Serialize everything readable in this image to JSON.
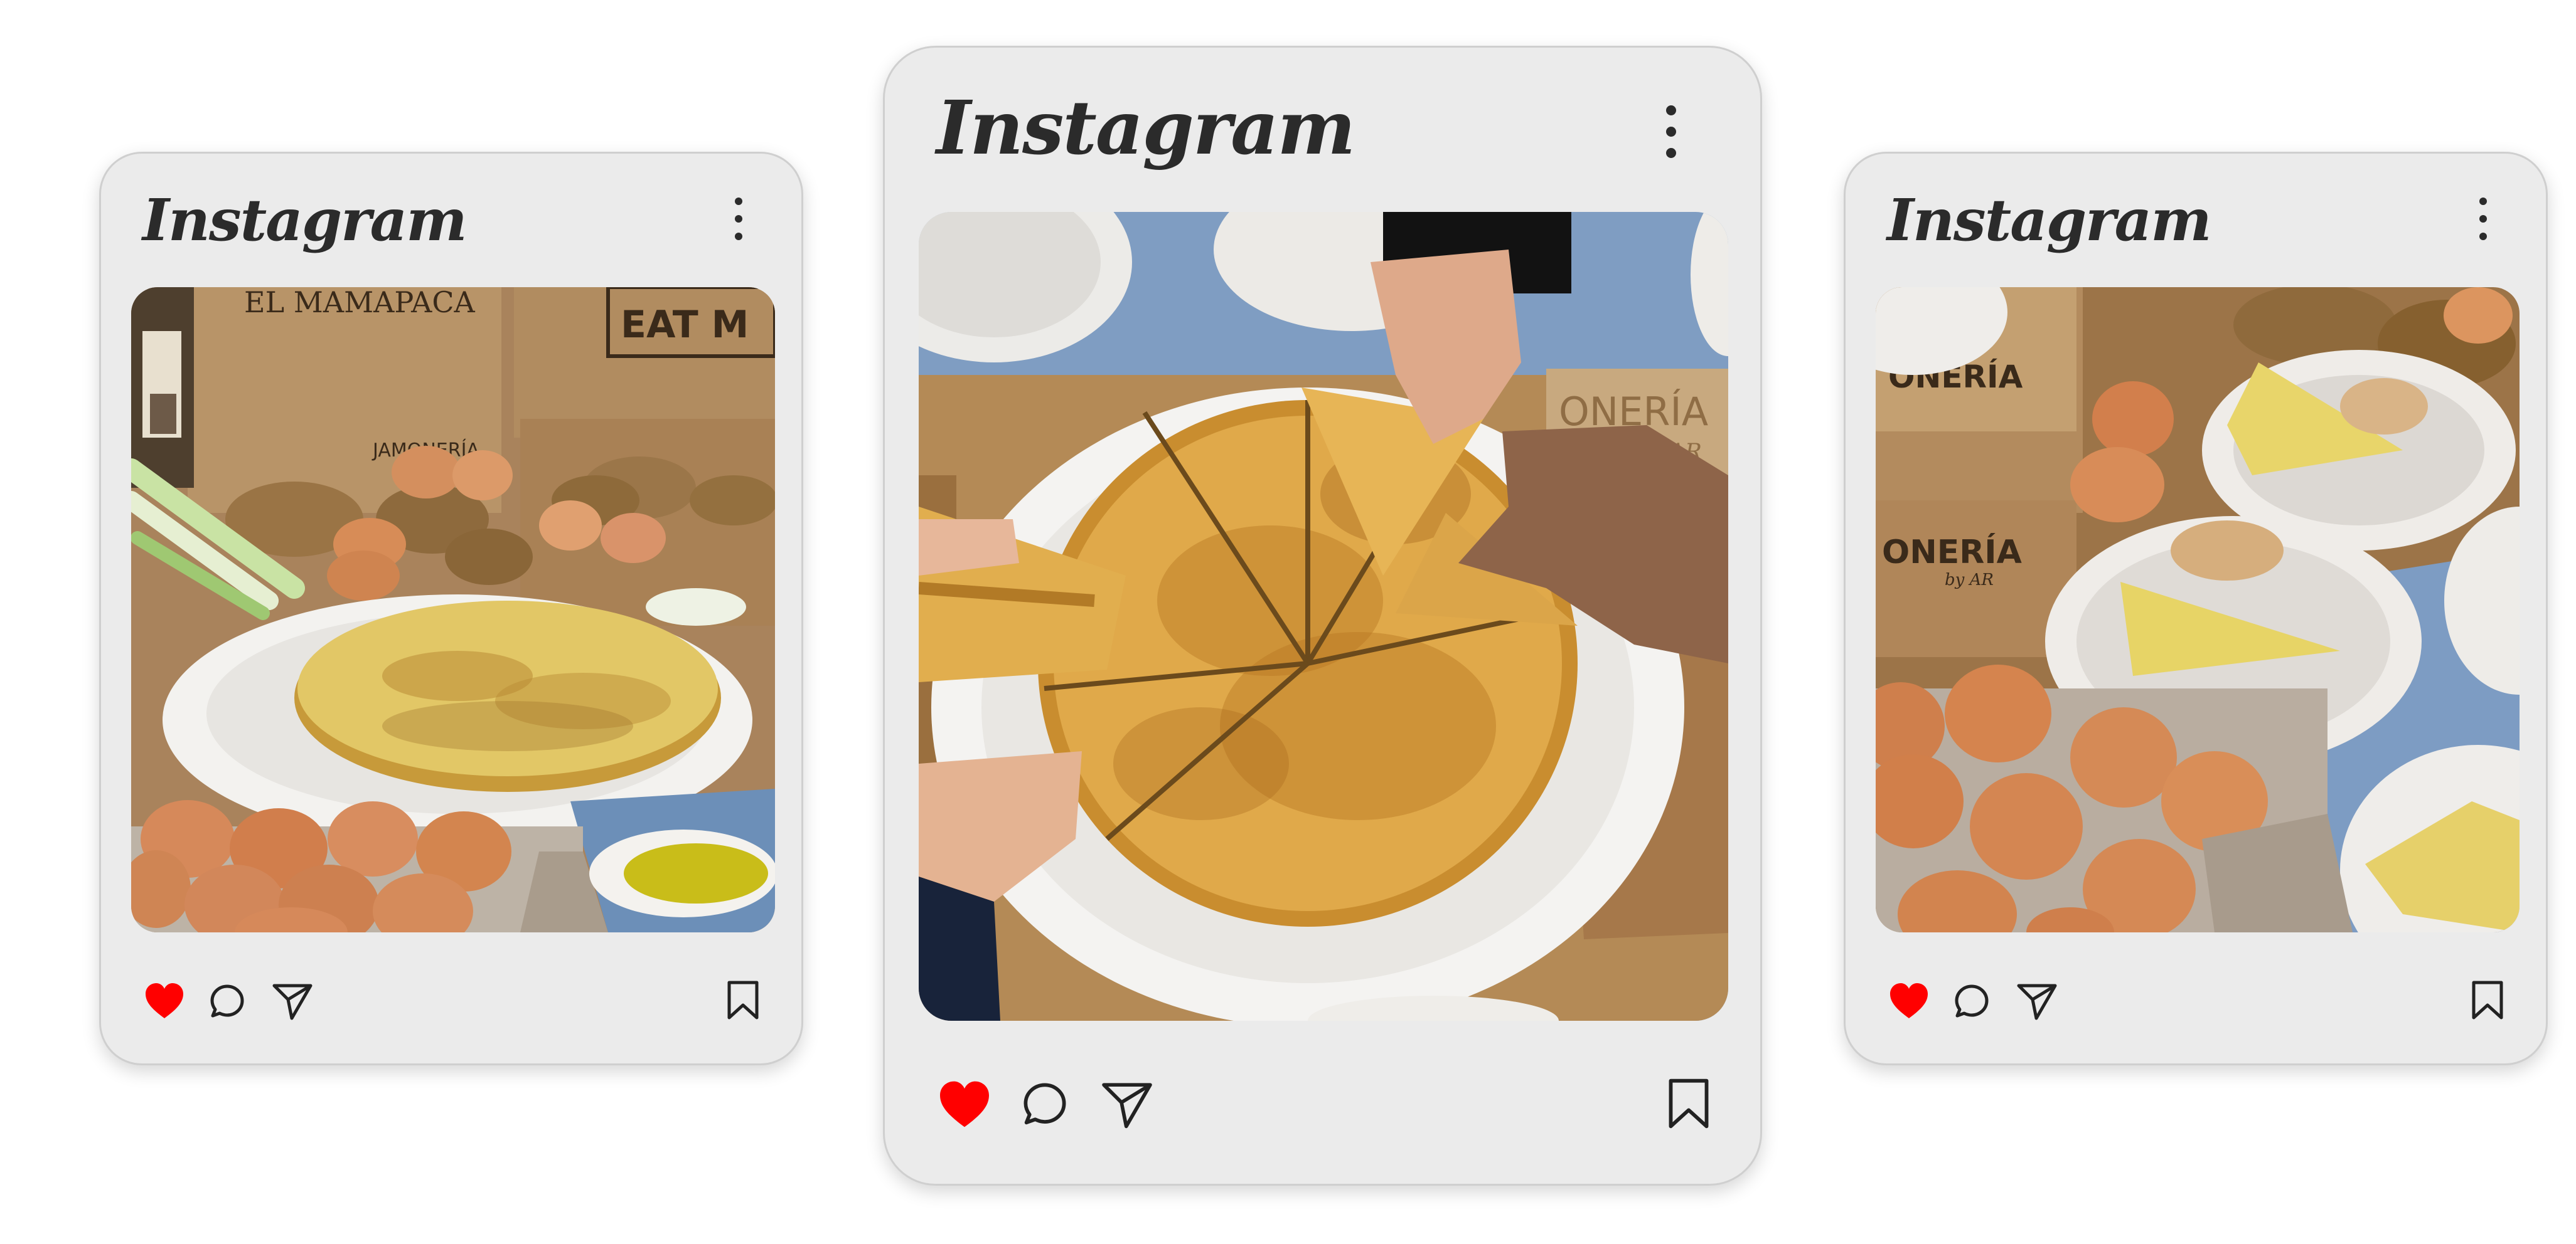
{
  "posts": [
    {
      "brand": "Instagram",
      "liked": true,
      "photo": "tortilla whole on plate with eggs, potatoes, boxes"
    },
    {
      "brand": "Instagram",
      "liked": true,
      "photo": "tortilla sliced, hands taking slices"
    },
    {
      "brand": "Instagram",
      "liked": true,
      "photo": "tortilla slices on plates with eggs and boxes"
    }
  ],
  "photo_text": {
    "left_box_1": "EL MAMAPACA",
    "left_box_2": "EAT M",
    "left_box_3": "JAMONERÍA",
    "center_box": "ONERÍA",
    "center_box_sub": "by AR",
    "right_box_1": "ONERÍA",
    "right_box_2": "ONERÍA",
    "right_box_sub": "by AR"
  },
  "icons": {
    "like": "heart-icon",
    "comment": "comment-bubble-icon",
    "share": "paper-plane-icon",
    "save": "bookmark-icon",
    "menu": "kebab-menu-icon"
  },
  "colors": {
    "like_red": "#ff0000",
    "card_bg": "#ebebeb",
    "icon_ink": "#222222"
  }
}
